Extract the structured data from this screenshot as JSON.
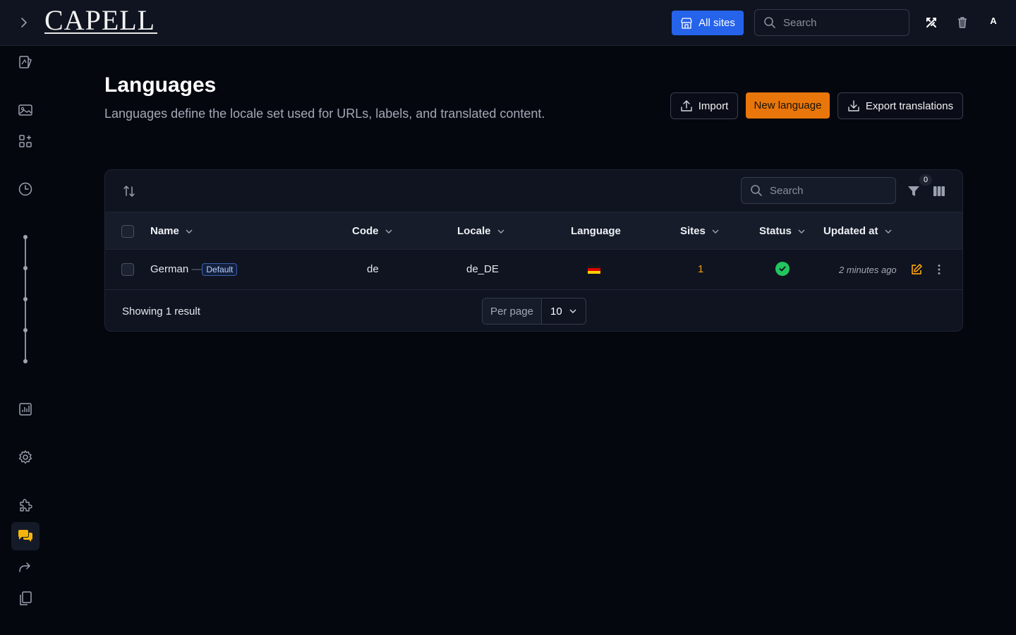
{
  "app": {
    "logo_text": "CAPELL",
    "all_sites_label": "All sites",
    "search_placeholder": "Search",
    "user_initial": "A"
  },
  "header": {
    "title": "Languages",
    "subtitle": "Languages define the locale set used for URLs, labels, and translated content.",
    "import_label": "Import",
    "new_label": "New language",
    "export_label": "Export translations"
  },
  "table": {
    "search_placeholder": "Search",
    "filter_count": "0",
    "columns": {
      "name": "Name",
      "code": "Code",
      "locale": "Locale",
      "language": "Language",
      "sites": "Sites",
      "status": "Status",
      "updated_at": "Updated at"
    },
    "rows": [
      {
        "name": "German",
        "separator": "—",
        "badge": "Default",
        "code": "de",
        "locale": "de_DE",
        "flag": "germany-flag",
        "sites": "1",
        "status": "active",
        "updated_at": "2 minutes ago"
      }
    ],
    "result_text": "Showing 1 result",
    "per_page_label": "Per page",
    "per_page_value": "10"
  },
  "colors": {
    "accent_orange": "#e8760a",
    "primary_blue": "#2563eb",
    "status_green": "#22c55e",
    "background": "#05070f"
  }
}
